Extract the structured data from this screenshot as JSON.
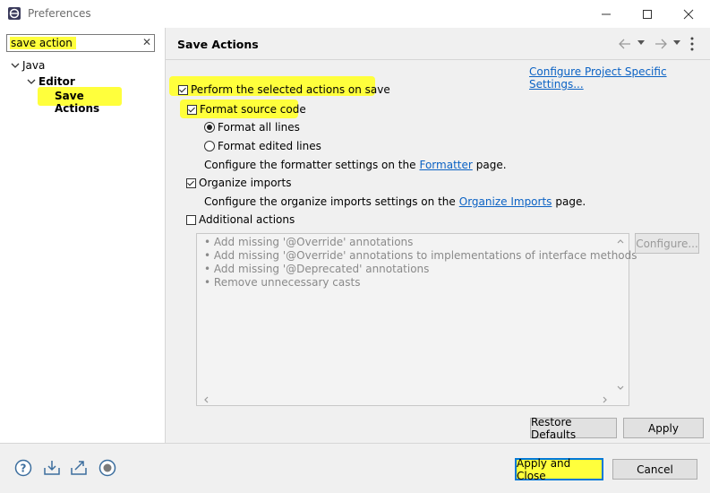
{
  "window": {
    "title": "Preferences"
  },
  "filter": {
    "value": "save action"
  },
  "tree": {
    "java": "Java",
    "editor": "Editor",
    "save_actions": "Save Actions"
  },
  "page": {
    "title": "Save Actions",
    "configure_project_link": "Configure Project Specific Settings...",
    "perform_label": "Perform the selected actions on save",
    "format_label": "Format source code",
    "format_all": "Format all lines",
    "format_edited": "Format edited lines",
    "formatter_pre": "Configure the formatter settings on the",
    "formatter_link": "Formatter",
    "formatter_post": "page.",
    "organize_label": "Organize imports",
    "organize_pre": "Configure the organize imports settings on the",
    "organize_link": "Organize Imports",
    "organize_post": "page.",
    "additional_label": "Additional actions",
    "additional_items": [
      "Add missing '@Override' annotations",
      "Add missing '@Override' annotations to implementations of interface methods",
      "Add missing '@Deprecated' annotations",
      "Remove unnecessary casts"
    ],
    "configure_button": "Configure...",
    "restore_defaults": "Restore Defaults",
    "apply": "Apply"
  },
  "footer": {
    "apply_close": "Apply and Close",
    "cancel": "Cancel"
  },
  "colors": {
    "highlight": "#ffff3c",
    "link": "#0b62c4",
    "focus_border": "#0078d7"
  }
}
